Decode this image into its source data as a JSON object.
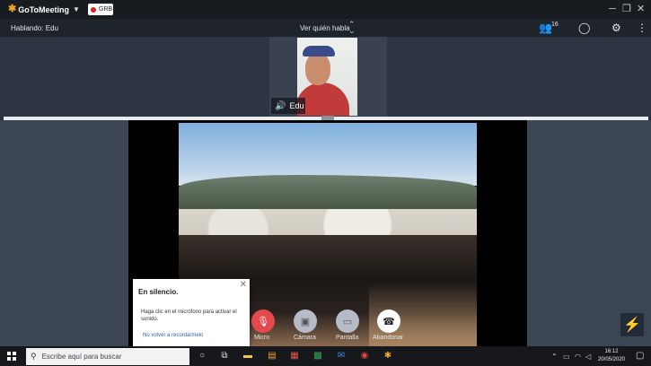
{
  "app": {
    "name": "GoToMeeting",
    "rec_label": "GRB"
  },
  "speaker_bar": {
    "speaking": "Hablando: Edu",
    "view_who": "Ver quién habla",
    "participant_count": "16"
  },
  "webcam": {
    "name": "Edu"
  },
  "toast": {
    "title": "En silencio.",
    "body": "Haga clic en el micrófono para activar el sonido.",
    "link": "No volver a recordármelo"
  },
  "controls": {
    "mic": "Micro",
    "camera": "Cámara",
    "screen": "Pantalla",
    "leave": "Abandonar"
  },
  "taskbar": {
    "search_placeholder": "Escribe aquí para buscar",
    "time": "16:12",
    "date": "20/05/2020"
  },
  "colors": {
    "mic_muted": "#e5484d",
    "brand_orange": "#f5a623",
    "speaking_green": "#2ecc71"
  }
}
